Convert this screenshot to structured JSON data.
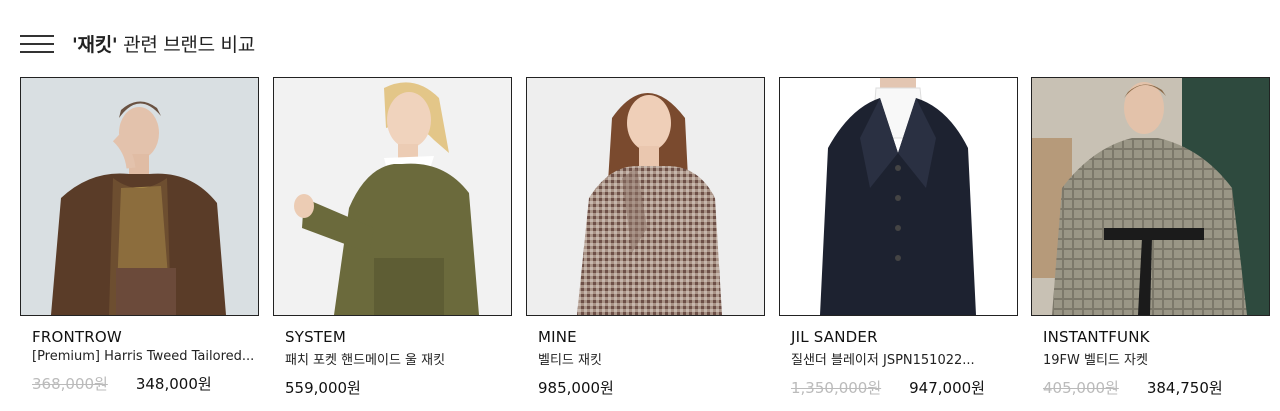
{
  "header": {
    "keyword": "'재킷'",
    "title_suffix": " 관련 브랜드 비교"
  },
  "products": [
    {
      "brand": "FRONTROW",
      "name": "[Premium] Harris Tweed Tailored...",
      "original_price": "368,000원",
      "price": "348,000원"
    },
    {
      "brand": "SYSTEM",
      "name": "패치 포켓 핸드메이드 울 재킷",
      "original_price": "",
      "price": "559,000원"
    },
    {
      "brand": "MINE",
      "name": "벨티드 재킷",
      "original_price": "",
      "price": "985,000원"
    },
    {
      "brand": "JIL SANDER",
      "name": "질샌더 블레이저 JSPN151022...",
      "original_price": "1,350,000원",
      "price": "947,000원"
    },
    {
      "brand": "INSTANTFUNK",
      "name": "19FW 벨티드 자켓",
      "original_price": "405,000원",
      "price": "384,750원"
    }
  ],
  "colors": {
    "text": "#222222",
    "strike": "#bbbbbb",
    "border": "#222222"
  }
}
